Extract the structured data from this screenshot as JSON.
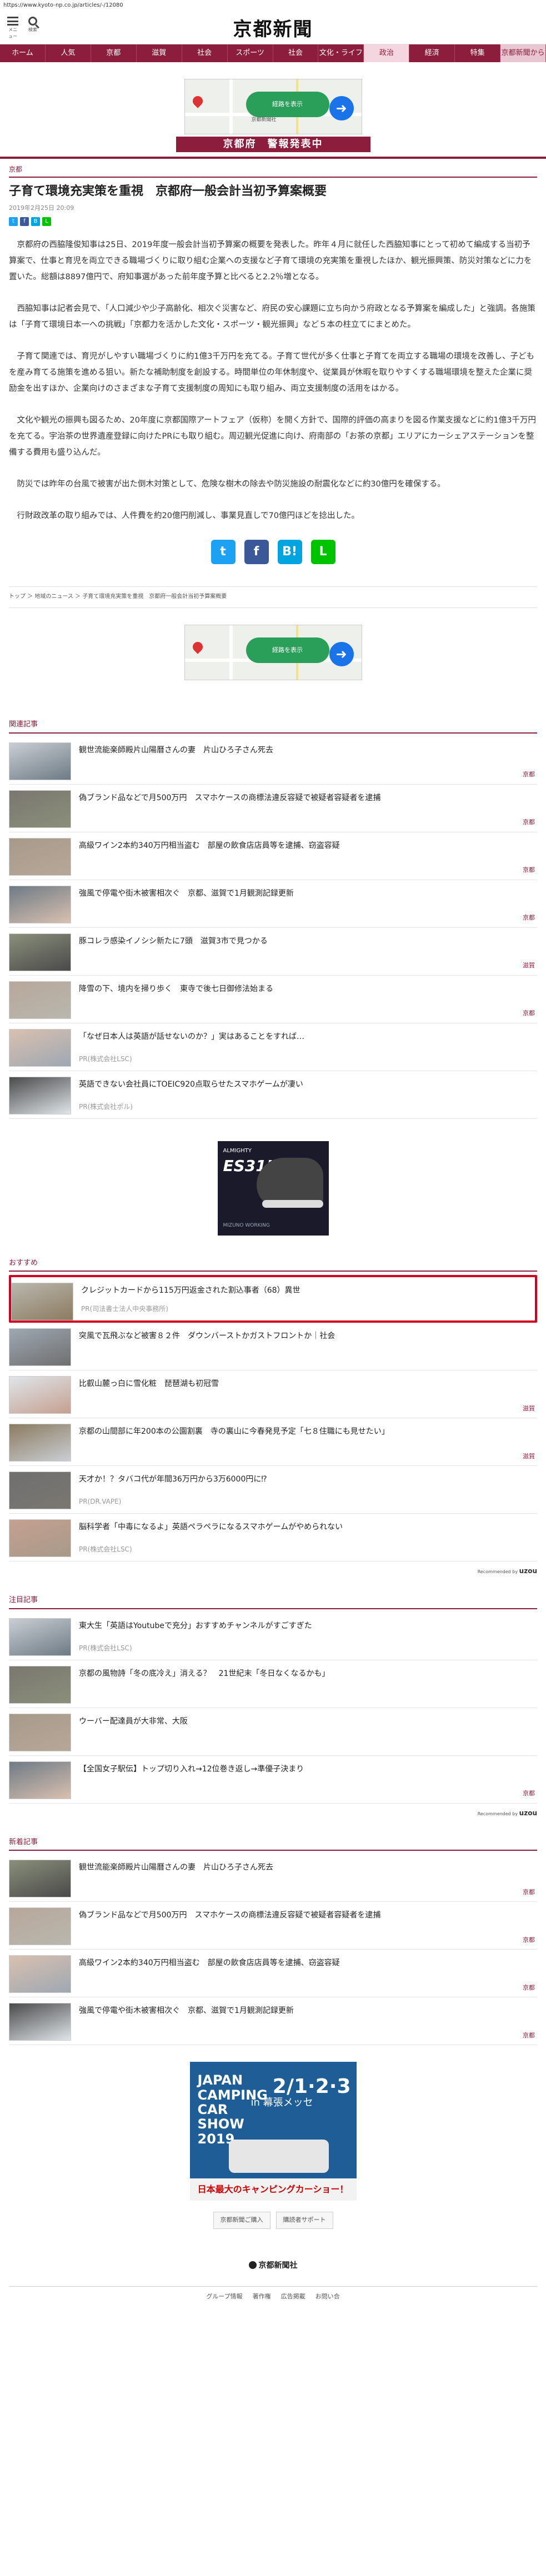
{
  "url": "https://www.kyoto-np.co.jp/articles/-/12080",
  "header": {
    "logo": "京都新聞",
    "menu_label": "メニュー",
    "search_label": "検索"
  },
  "nav": [
    "ホーム",
    "人気",
    "京都",
    "滋賀",
    "社会",
    "スポーツ",
    "社会",
    "文化・ライフ",
    "政治",
    "経済",
    "特集",
    "京都新聞から"
  ],
  "nav_active_index": 8,
  "ad_map_label": "京都新聞社",
  "ad_map_button": "経路を表示",
  "alert": "京都府　警報発表中",
  "section": "京都",
  "article": {
    "title": "子育て環境充実策を重視　京都府一般会計当初予算案概要",
    "date": "2019年2月25日 20:09",
    "paragraphs": [
      "京都府の西脇隆俊知事は25日、2019年度一般会計当初予算案の概要を発表した。昨年４月に就任した西脇知事にとって初めて編成する当初予算案で、仕事と育児を両立できる職場づくりに取り組む企業への支援など子育て環境の充実策を重視したほか、観光振興策、防災対策などに力を置いた。総額は8897億円で、府知事選があった前年度予算と比べると2.2％増となる。",
      "西脇知事は記者会見で、「人口減少や少子高齢化、相次ぐ災害など、府民の安心課題に立ち向かう府政となる予算案を編成した」と強調。各施策は「子育て環境日本一への挑戦」「京都力を活かした文化・スポーツ・観光振興」など５本の柱立てにまとめた。",
      "子育て関連では、育児がしやすい職場づくりに約1億3千万円を充てる。子育て世代が多く仕事と子育てを両立する職場の環境を改善し、子どもを産み育てる施策を進める狙い。新たな補助制度を創設する。時間単位の年休制度や、従業員が休暇を取りやすくする職場環境を整えた企業に奨励金を出すほか、企業向けのさまざまな子育て支援制度の周知にも取り組み、両立支援制度の活用をはかる。",
      "文化や観光の振興も図るため、20年度に京都国際アートフェア（仮称）を開く方針で、国際的評価の高まりを図る作業支援などに約1億3千万円を充てる。宇治茶の世界遺産登録に向けたPRにも取り組む。周辺観光促進に向け、府南部の「お茶の京都」エリアにカーシェアステーションを整備する費用も盛り込んだ。",
      "防災では昨年の台風で被害が出た倒木対策として、危険な樹木の除去や防災施設の耐震化などに約30億円を確保する。",
      "行財政改革の取り組みでは、人件費を約20億円削減し、事業見直しで70億円ほどを捻出した。"
    ]
  },
  "breadcrumb": "トップ ＞ 地域のニュース ＞ 子育て環境充実策を重視　京都府一般会計当初予算案概要",
  "related_header": "関連記事",
  "related": [
    {
      "title": "観世流能楽師殿片山陽曆さんの妻　片山ひろ子さん死去",
      "cat": "京都",
      "pr": ""
    },
    {
      "title": "偽ブランド品などで月500万円　スマホケースの商標法違反容疑で被疑者容疑者を逮捕",
      "cat": "京都",
      "pr": ""
    },
    {
      "title": "高級ワイン2本約340万円相当盗む　部屋の飲食店店員等を逮捕、窃盗容疑",
      "cat": "京都",
      "pr": ""
    },
    {
      "title": "強風で停電や街木被害相次ぐ　京都、滋賀で1月観測記録更新",
      "cat": "京都",
      "pr": ""
    },
    {
      "title": "豚コレラ感染イノシシ新たに7頭　滋賀3市で見つかる",
      "cat": "滋賀",
      "pr": ""
    },
    {
      "title": "降雪の下、境内を掃り歩く　東寺で後七日御修法始まる",
      "cat": "京都",
      "pr": ""
    },
    {
      "title": "「なぜ日本人は英語が話せないのか？」実はあることをすれば…",
      "cat": "",
      "pr": "PR(株式会社LSC)"
    },
    {
      "title": "英語できない会社員にTOEIC920点取らせたスマホゲームが凄い",
      "cat": "",
      "pr": "PR(株式会社ポル)"
    }
  ],
  "banner": {
    "brand": "ALMIGHTY",
    "model": "ES31L",
    "foot": "MIZUNO WORKING"
  },
  "recommend_header": "おすすめ",
  "recommend": [
    {
      "title": "クレジットカードから115万円返金された割込事者（68）異世",
      "cat": "",
      "pr": "PR(司法書士法人中央事務所)"
    },
    {
      "title": "突風で瓦飛ぶなど被害８２件　ダウンバーストかガストフロントか｜社会",
      "cat": "",
      "pr": ""
    },
    {
      "title": "比叡山麓っ白に雪化粧　琵琶湖も初冠雪",
      "cat": "滋賀",
      "pr": ""
    },
    {
      "title": "京都の山間部に年200本の公園割裏　寺の裏山に今春発見予定「七８住職にも見せたい」",
      "cat": "滋賀",
      "pr": ""
    },
    {
      "title": "天才か！？タバコ代が年間36万円から3万6000円に⁉︎",
      "cat": "",
      "pr": "PR(DR.VAPE)"
    },
    {
      "title": "脳科学者「中毒になるよ」英語ペラペラになるスマホゲームがやめられない",
      "cat": "",
      "pr": "PR(株式会社LSC)"
    }
  ],
  "powered_label": "Recommended by",
  "powered_brand": "uzou",
  "attention_header": "注目記事",
  "attention": [
    {
      "title": "東大生「英語はYoutubeで充分」おすすめチャンネルがすごすぎた",
      "cat": "",
      "pr": "PR(株式会社LSC)"
    },
    {
      "title": "京都の風物詩「冬の底冷え」消える？　21世紀末「冬日なくなるかも」",
      "cat": "",
      "pr": ""
    },
    {
      "title": "ウーバー配達員が大非常、大阪",
      "cat": "",
      "pr": ""
    },
    {
      "title": "【全国女子駅伝】トップ切り入れ→12位巻き返し→準優子決まり",
      "cat": "京都",
      "pr": ""
    }
  ],
  "new_header": "新着記事",
  "newest": [
    {
      "title": "観世流能楽師殿片山陽曆さんの妻　片山ひろ子さん死去",
      "cat": "京都"
    },
    {
      "title": "偽ブランド品などで月500万円　スマホケースの商標法違反容疑で被疑者容疑者を逮捕",
      "cat": "京都"
    },
    {
      "title": "高級ワイン2本約340万円相当盗む　部屋の飲食店店員等を逮捕、窃盗容疑",
      "cat": "京都"
    },
    {
      "title": "強風で停電や街木被害相次ぐ　京都、滋賀で1月観測記録更新",
      "cat": "京都"
    }
  ],
  "footer_ad": {
    "title": "JAPAN CAMPING CAR SHOW 2019",
    "date": "2/1·2·3",
    "venue": "in 幕張メッセ",
    "strip": "日本最大のキャンピングカーショー！"
  },
  "small_buttons": [
    "京都新聞ご購入",
    "購読者サポート"
  ],
  "footer_logo": "京都新聞社",
  "footer_links": [
    "グループ情報",
    "著作権",
    "広告掲載",
    "お問い合"
  ],
  "colors": {
    "brand": "#8c1d3c",
    "highlight": "#d10020"
  }
}
